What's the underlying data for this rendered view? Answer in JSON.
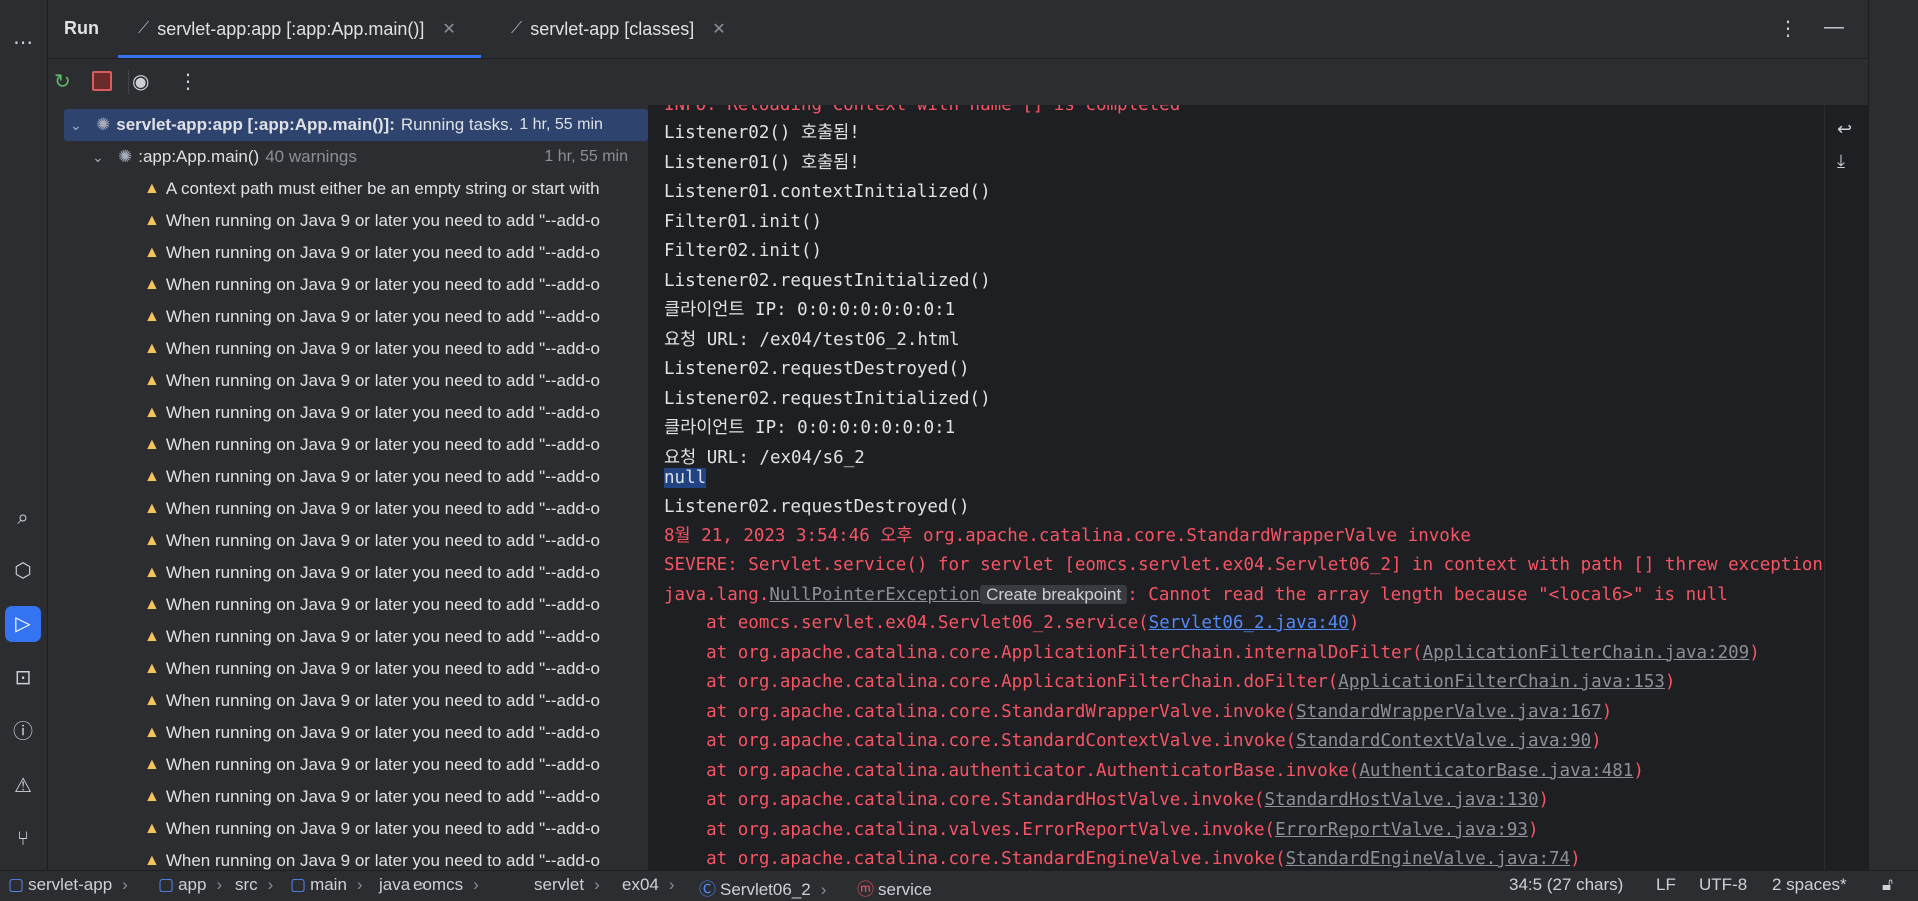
{
  "window": {
    "title": "Run",
    "tabs": [
      {
        "label": "servlet-app:app [:app:App.main()]",
        "icon": "run-config-icon"
      },
      {
        "label": "servlet-app [classes]",
        "icon": "run-config-icon"
      }
    ]
  },
  "tree": {
    "root": {
      "label": "servlet-app:app [:app:App.main()]:",
      "status": "Running tasks.",
      "time": "1 hr, 55 min"
    },
    "child": {
      "label": ":app:App.main()",
      "warnings": "40 warnings",
      "time": "1 hr, 55 min"
    },
    "items": [
      "A context path must either be an empty string or start with",
      "When running on Java 9 or later you need to add \"--add-o",
      "When running on Java 9 or later you need to add \"--add-o",
      "When running on Java 9 or later you need to add \"--add-o",
      "When running on Java 9 or later you need to add \"--add-o",
      "When running on Java 9 or later you need to add \"--add-o",
      "When running on Java 9 or later you need to add \"--add-o",
      "When running on Java 9 or later you need to add \"--add-o",
      "When running on Java 9 or later you need to add \"--add-o",
      "When running on Java 9 or later you need to add \"--add-o",
      "When running on Java 9 or later you need to add \"--add-o",
      "When running on Java 9 or later you need to add \"--add-o",
      "When running on Java 9 or later you need to add \"--add-o",
      "When running on Java 9 or later you need to add \"--add-o",
      "When running on Java 9 or later you need to add \"--add-o",
      "When running on Java 9 or later you need to add \"--add-o",
      "When running on Java 9 or later you need to add \"--add-o",
      "When running on Java 9 or later you need to add \"--add-o",
      "When running on Java 9 or later you need to add \"--add-o",
      "When running on Java 9 or later you need to add \"--add-o",
      "When running on Java 9 or later you need to add \"--add-o",
      "When running on Java 9 or later you need to add \"--add-o"
    ]
  },
  "console": {
    "partial_top": "INFO: Reloading Context with name [] is completed",
    "lines": [
      "Listener02() 호출됨!",
      "Listener01() 호출됨!",
      "Listener01.contextInitialized()",
      "Filter01.init()",
      "Filter02.init()",
      "Listener02.requestInitialized()",
      "클라이언트 IP: 0:0:0:0:0:0:0:1",
      "요청 URL: /ex04/test06_2.html",
      "Listener02.requestDestroyed()",
      "Listener02.requestInitialized()",
      "클라이언트 IP: 0:0:0:0:0:0:0:1",
      "요청 URL: /ex04/s6_2"
    ],
    "null_line": "null",
    "after_null": "Listener02.requestDestroyed()",
    "err1": "8월 21, 2023 3:54:46 오후 org.apache.catalina.core.StandardWrapperValve invoke",
    "err2": "SEVERE: Servlet.service() for servlet [eomcs.servlet.ex04.Servlet06_2] in context with path [] threw exception",
    "npe_prefix": "java.lang.",
    "npe_class": "NullPointerException",
    "npe_button": "Create breakpoint",
    "npe_msg": ": Cannot read the array length because \"<local6>\" is null",
    "stack": [
      {
        "text": "    at eomcs.servlet.ex04.Servlet06_2.service(",
        "link": "Servlet06_2.java:40",
        "own": true
      },
      {
        "text": "    at org.apache.catalina.core.ApplicationFilterChain.internalDoFilter(",
        "link": "ApplicationFilterChain.java:209",
        "own": false
      },
      {
        "text": "    at org.apache.catalina.core.ApplicationFilterChain.doFilter(",
        "link": "ApplicationFilterChain.java:153",
        "own": false
      },
      {
        "text": "    at org.apache.catalina.core.StandardWrapperValve.invoke(",
        "link": "StandardWrapperValve.java:167",
        "own": false
      },
      {
        "text": "    at org.apache.catalina.core.StandardContextValve.invoke(",
        "link": "StandardContextValve.java:90",
        "own": false
      },
      {
        "text": "    at org.apache.catalina.authenticator.AuthenticatorBase.invoke(",
        "link": "AuthenticatorBase.java:481",
        "own": false
      },
      {
        "text": "    at org.apache.catalina.core.StandardHostValve.invoke(",
        "link": "StandardHostValve.java:130",
        "own": false
      },
      {
        "text": "    at org.apache.catalina.valves.ErrorReportValve.invoke(",
        "link": "ErrorReportValve.java:93",
        "own": false
      },
      {
        "text": "    at org.apache.catalina.core.StandardEngineValve.invoke(",
        "link": "StandardEngineValve.java:74",
        "own": false
      }
    ]
  },
  "statusbar": {
    "breadcrumbs": [
      "servlet-app",
      "app",
      "src",
      "main",
      "java",
      "eomcs",
      "servlet",
      "ex04",
      "Servlet06_2",
      "service"
    ],
    "position": "34:5 (27 chars)",
    "line_ending": "LF",
    "encoding": "UTF-8",
    "indent": "2 spaces*"
  },
  "colors": {
    "accent": "#3574f0",
    "error": "#f75464",
    "warning": "#f2c55c",
    "link": "#548af7"
  }
}
